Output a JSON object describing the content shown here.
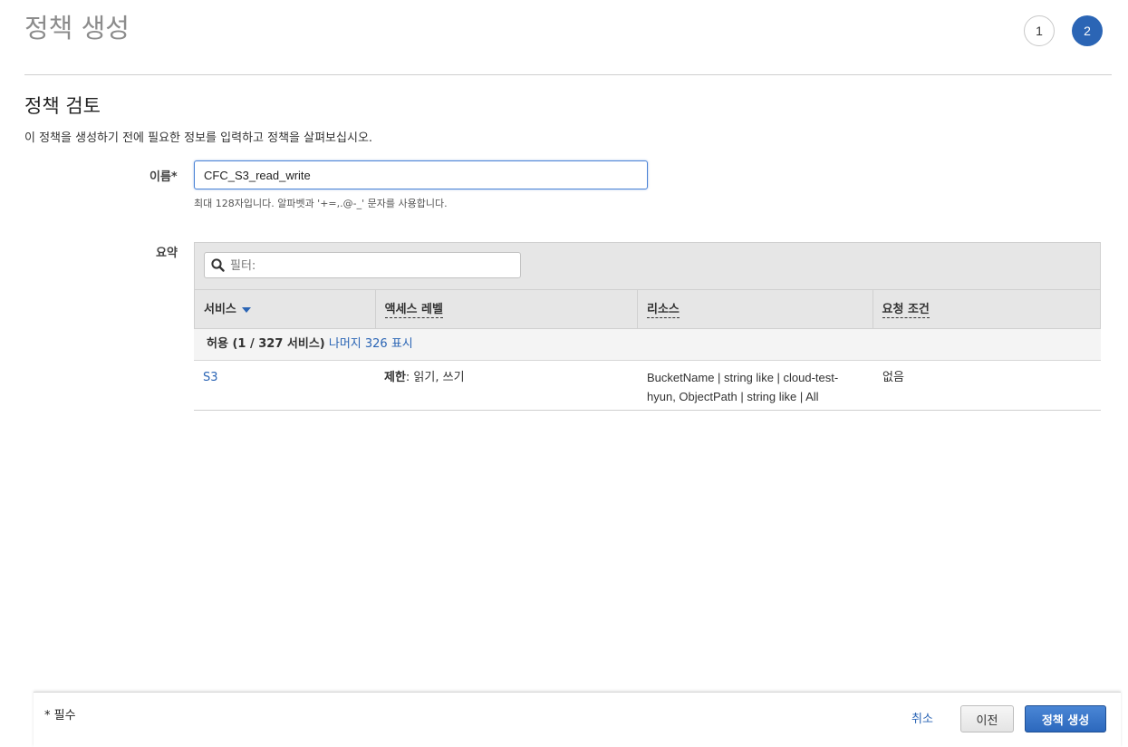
{
  "header": {
    "title": "정책 생성",
    "steps": [
      "1",
      "2"
    ],
    "active_step": "2"
  },
  "review": {
    "title": "정책 검토",
    "description": "이 정책을 생성하기 전에 필요한 정보를 입력하고 정책을 살펴보십시오."
  },
  "name_field": {
    "label": "이름*",
    "value": "CFC_S3_read_write",
    "hint": "최대 128자입니다. 알파벳과 '+=,.@-_' 문자를 사용합니다."
  },
  "summary": {
    "label": "요약",
    "filter_placeholder": "필터:",
    "columns": [
      "서비스",
      "액세스 레벨",
      "리소스",
      "요청 조건"
    ],
    "group": {
      "label": "허용 (1 / 327 서비스)",
      "link": "나머지 326 표시"
    },
    "rows": [
      {
        "service": "S3",
        "access_bold": "제한",
        "access_rest": ": 읽기, 쓰기",
        "resource": "BucketName | string like | cloud-test-hyun, ObjectPath | string like | All",
        "condition": "없음"
      }
    ]
  },
  "footer": {
    "required_note": "* 필수",
    "cancel_label": "취소",
    "prev_label": "이전",
    "create_label": "정책 생성"
  },
  "colors": {
    "accent": "#2b65b5",
    "primary_button": "#2c68bd"
  }
}
